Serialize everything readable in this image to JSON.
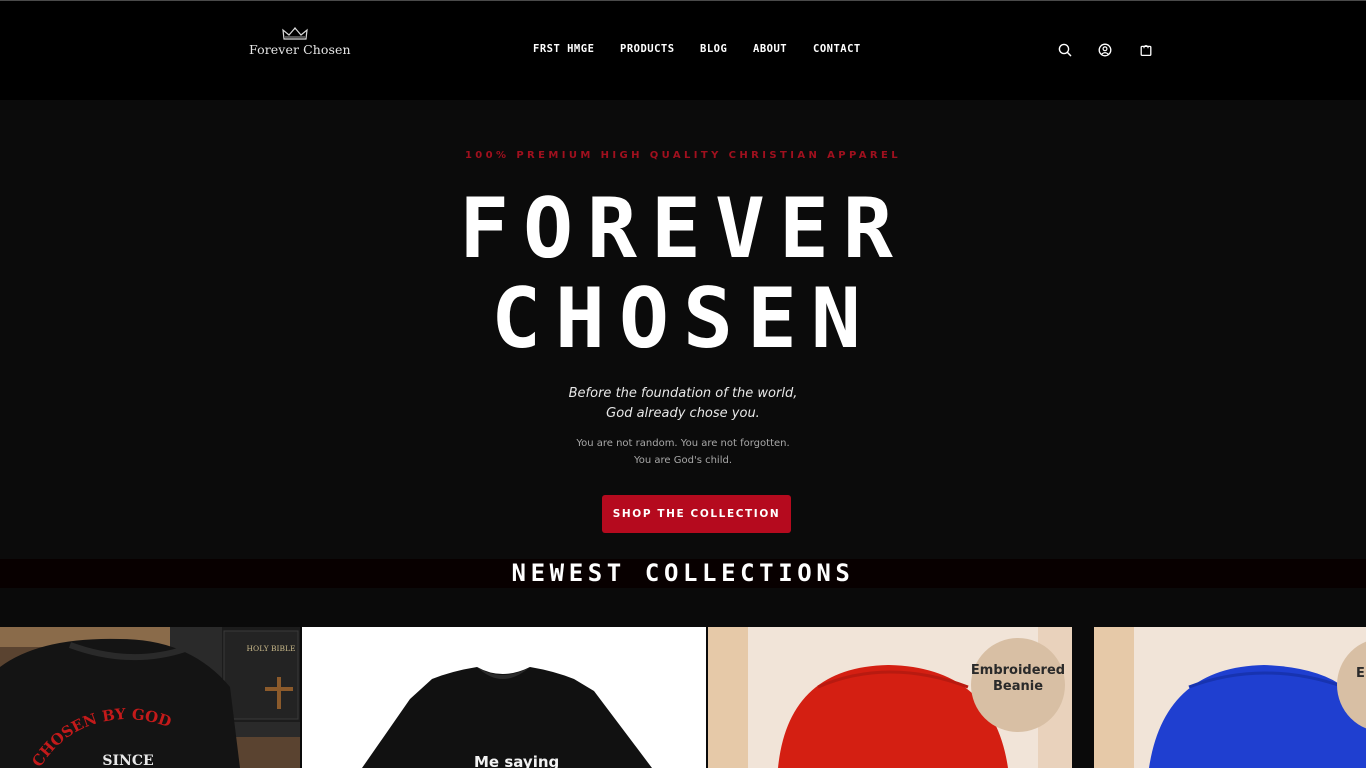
{
  "header": {
    "logo_text": "Forever Chosen",
    "nav": [
      "FRST HMGE",
      "PRODUCTS",
      "BLOG",
      "ABOUT",
      "CONTACT"
    ],
    "icons": [
      "search-icon",
      "account-icon",
      "cart-icon"
    ]
  },
  "hero": {
    "eyebrow": "100% PREMIUM HIGH QUALITY CHRISTIAN APPAREL",
    "title_line1": "FOREVER",
    "title_line2": "CHOSEN",
    "tagline_line1": "Before the foundation of the world,",
    "tagline_line2": "God already chose you.",
    "subtext_line1": "You are not random. You are not forgotten.",
    "subtext_line2": "You are God's child.",
    "cta_label": "SHOP THE COLLECTION"
  },
  "collections": {
    "title": "NEWEST COLLECTIONS",
    "products": [
      {
        "image_text_1": "HOLY BIBLE",
        "image_text_2": "CHOSEN BY GOD",
        "image_text_3": "SINCE"
      },
      {
        "image_text_1": "Me saying"
      },
      {
        "badge_text_1": "Embroidered",
        "badge_text_2": "Beanie"
      },
      {
        "badge_text_1": "E"
      }
    ]
  },
  "colors": {
    "accent_red": "#b50a1e",
    "header_bg": "#000000",
    "hero_bg": "#0b0b0b"
  }
}
